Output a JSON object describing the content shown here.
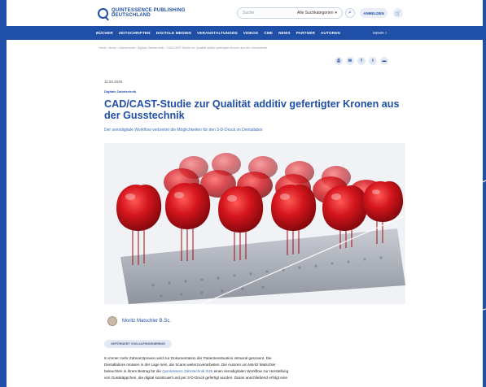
{
  "header": {
    "logo": {
      "line1": "QUINTESSENCE PUBLISHING",
      "line2": "DEUTSCHLAND"
    },
    "search": {
      "placeholder": "Suche",
      "category": "Alle Suchkategorien"
    },
    "login_label": "ANMELDEN"
  },
  "nav": {
    "items": [
      "BÜCHER",
      "ZEITSCHRIFTEN",
      "DIGITALE MEDIEN",
      "VERANSTALTUNGEN",
      "VIDEOS",
      "CME",
      "NEWS",
      "PARTNER",
      "AUTOREN"
    ],
    "more_label": "MEHR"
  },
  "breadcrumb": "Home › News › Zahntechnik › Digitale Zahntechnik › CAD/CAST-Studie zur Qualität additiv gefertigter Kronen aus der Gusstechnik",
  "share": {
    "icons": [
      "print-icon",
      "email-icon",
      "facebook-icon",
      "twitter-icon",
      "mail-icon"
    ]
  },
  "article": {
    "date": "11.03.2025",
    "category": "Digitale Zahntechnik",
    "title": "CAD/CAST-Studie zur Qualität additiv gefertigter Kronen aus der Gusstechnik",
    "subtitle": "Der semidigitale Workflow verbreitet die Möglichkeiten für den 3-D-Druck im Dentallabor",
    "author": "Moritz Matschler B.Sc.",
    "sponsored": "GEFÖRDERT VON AUFINGENIERING",
    "body_lines": [
      "In immer mehr Zahnarztpraxen wird zur Dokumentation der Patientensituation intraoral gescannt. Die",
      "Dentallabore müssen in der Lage sein, die Scans weiterzuverarbeiten. Die Autoren um Moritz Matschler",
      "beleuchten in ihrem Beitrag für die",
      "Quintessenz Zahntechnik 3/25",
      "einen semidigitalen Workflow zur Herstellung",
      "von Gusskäppchen, die digital konstruiert und per 3-D-Druck gefertigt wurden. Daran anschließend erfolgt eine"
    ]
  },
  "colors": {
    "brand": "#1f4fa6",
    "accent": "#3d6cc0",
    "resin": "#c8141c"
  }
}
